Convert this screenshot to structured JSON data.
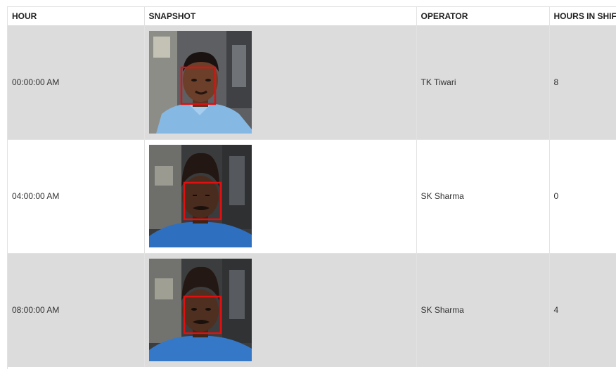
{
  "columns": {
    "hour": "HOUR",
    "snapshot": "SNAPSHOT",
    "operator": "OPERATOR",
    "hours_in_shift": "HOURS IN SHIF"
  },
  "rows": [
    {
      "hour": "00:00:00 AM",
      "operator": "TK Tiwari",
      "hours_in_shift": "8"
    },
    {
      "hour": "04:00:00 AM",
      "operator": "SK Sharma",
      "hours_in_shift": "0"
    },
    {
      "hour": "08:00:00 AM",
      "operator": "SK Sharma",
      "hours_in_shift": "4"
    }
  ],
  "colors": {
    "row_shade": "#dcdcdc",
    "face_box": "#e01010"
  }
}
